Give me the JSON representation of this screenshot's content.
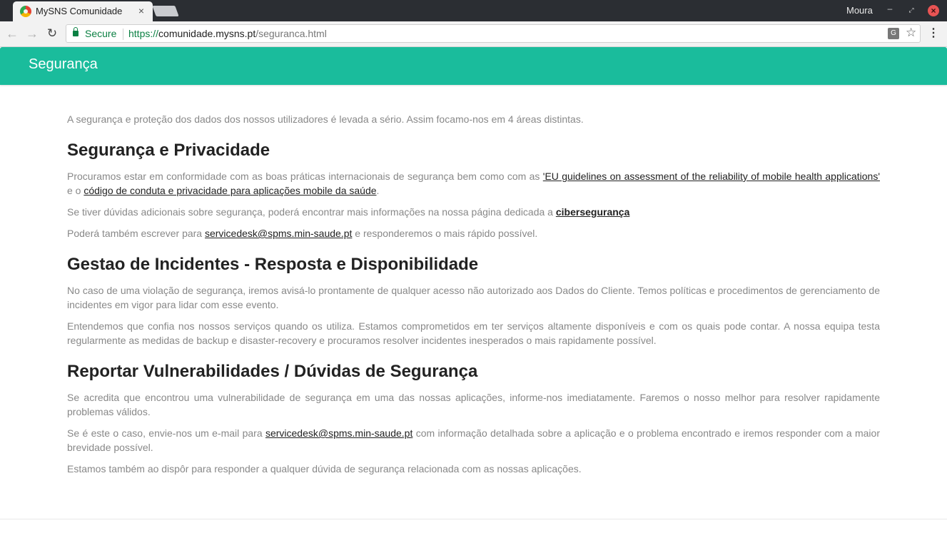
{
  "browser": {
    "tab_title": "MySNS Comunidade",
    "tab_close": "×",
    "profile_name": "Moura",
    "secure_label": "Secure",
    "url_scheme": "https://",
    "url_host": "comunidade.mysns.pt",
    "url_path": "/seguranca.html"
  },
  "header": {
    "title": "Segurança",
    "color": "#1abc9c"
  },
  "content": {
    "intro": "A segurança e proteção dos dados dos nossos utilizadores é levada a sério. Assim focamo-nos em 4 áreas distintas.",
    "section1": {
      "heading": "Segurança e Privacidade",
      "p1_text_a": "Procuramos estar em conformidade com as boas práticas internacionais de segurança bem como com as ",
      "p1_link1": "'EU guidelines on assessment of the reliability of mobile health applications'",
      "p1_text_b": " e o ",
      "p1_link2": "código de conduta e privacidade para aplicações mobile da saúde",
      "p1_text_c": ".",
      "p2_text": "Se tiver dúvidas adicionais sobre segurança, poderá encontrar mais informações na nossa página dedicada a ",
      "p2_link": "cibersegurança",
      "p3_text_a": "Poderá também escrever para ",
      "p3_link": "servicedesk@spms.min-saude.pt",
      "p3_text_b": " e responderemos o mais rápido possível."
    },
    "section2": {
      "heading": "Gestao de Incidentes - Resposta e Disponibilidade",
      "p1": "No caso de uma violação de segurança, iremos avisá-lo prontamente de qualquer acesso não autorizado aos Dados do Cliente. Temos políticas e procedimentos de gerenciamento de incidentes em vigor para lidar com esse evento.",
      "p2": "Entendemos que confia nos nossos serviços quando os utiliza. Estamos comprometidos em ter serviços altamente disponíveis e com os quais pode contar. A nossa equipa testa regularmente as medidas de backup e disaster-recovery e procuramos resolver incidentes inesperados o mais rapidamente possível."
    },
    "section3": {
      "heading": "Reportar Vulnerabilidades / Dúvidas de Segurança",
      "p1": "Se acredita que encontrou uma vulnerabilidade de segurança em uma das nossas aplicações, informe-nos imediatamente. Faremos o nosso melhor para resolver rapidamente problemas válidos.",
      "p2_text_a": "Se é este o caso, envie-nos um e-mail para ",
      "p2_link": "servicedesk@spms.min-saude.pt",
      "p2_text_b": " com informação detalhada sobre a aplicação e o problema encontrado e iremos responder com a maior brevidade possível.",
      "p3": "Estamos também ao dispôr para responder a qualquer dúvida de segurança relacionada com as nossas aplicações."
    }
  }
}
